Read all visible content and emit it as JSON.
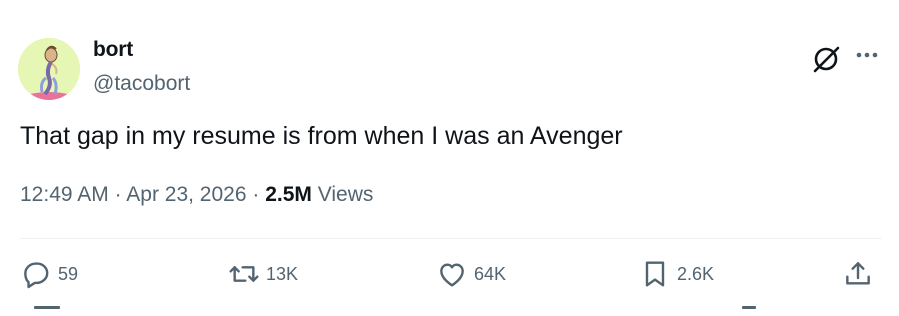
{
  "author": {
    "display_name": "bort",
    "handle": "@tacobort",
    "avatar_icon": "avatar-illustration"
  },
  "tweet": {
    "text": "That gap in my resume is from when I was an Avenger",
    "time": "12:49 AM",
    "separator_1": "·",
    "date": "Apr 23, 2026",
    "separator_2": "·",
    "views_count": "2.5M",
    "views_label": "Views"
  },
  "header_icons": [
    "grok-icon",
    "more-icon"
  ],
  "actions": {
    "reply": {
      "icon": "reply-icon",
      "count": "59"
    },
    "repost": {
      "icon": "repost-icon",
      "count": "13K"
    },
    "like": {
      "icon": "like-icon",
      "count": "64K"
    },
    "bookmark": {
      "icon": "bookmark-icon",
      "count": "2.6K"
    },
    "share": {
      "icon": "share-icon"
    }
  },
  "colors": {
    "text_primary": "#0f1419",
    "text_secondary": "#536471",
    "divider": "#eff3f4",
    "avatar_bg": "#e6f6b4",
    "avatar_accent": "#e8729a"
  }
}
